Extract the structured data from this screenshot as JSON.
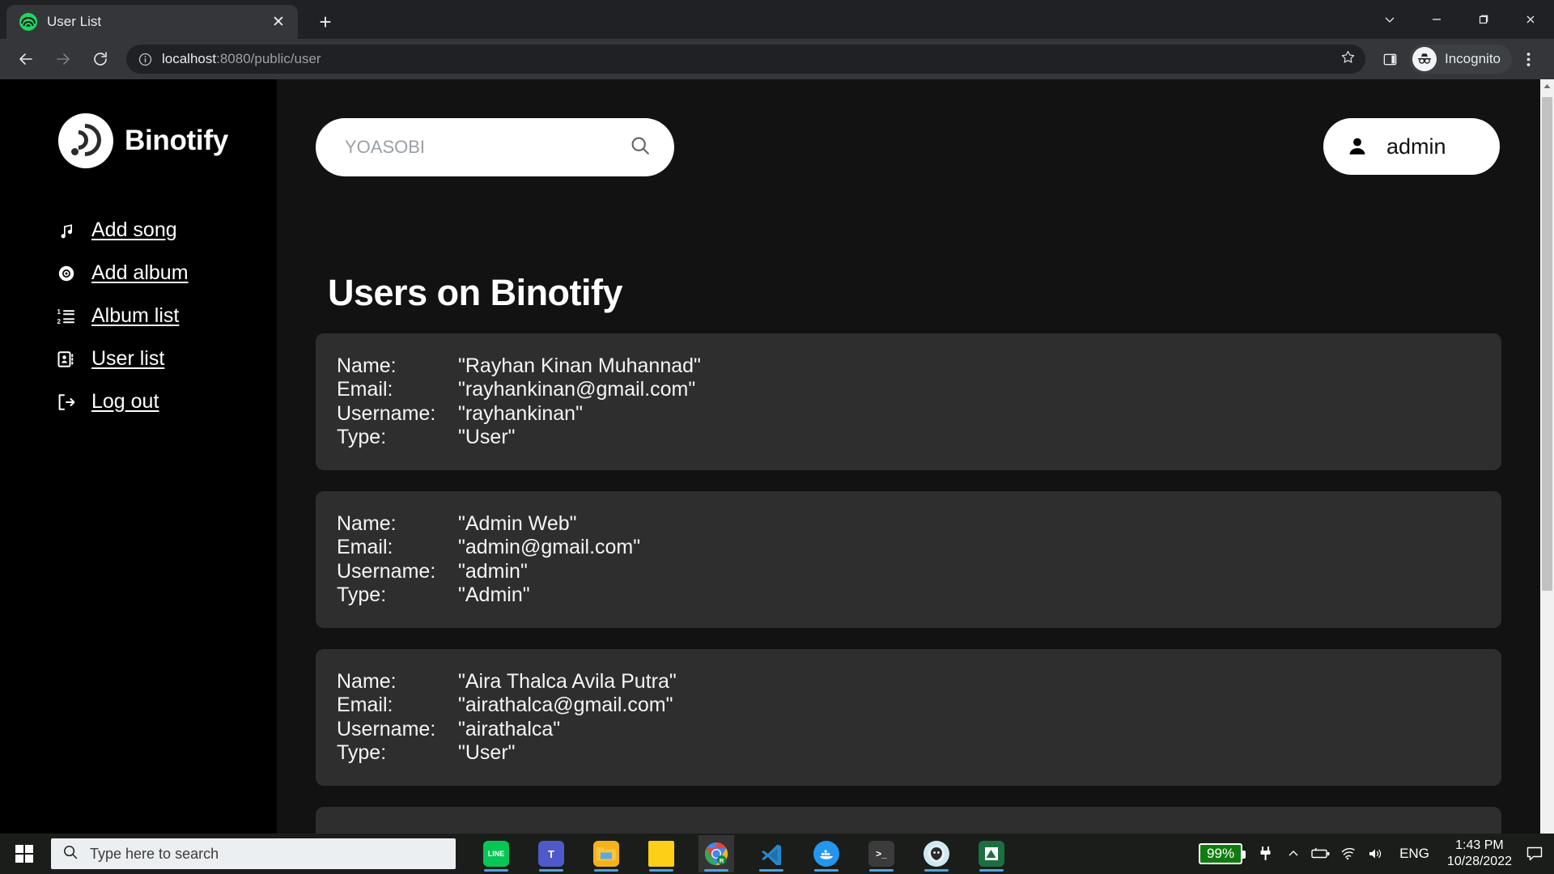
{
  "browser": {
    "tab": {
      "title": "User List",
      "favicon": "spotify-icon",
      "close_label": "✕"
    },
    "new_tab_label": "+",
    "address": {
      "scheme_host": "localhost",
      "path": ":8080/public/user",
      "full": "localhost:8080/public/user"
    },
    "profile_label": "Incognito",
    "window_controls": {
      "search_tabs": "chevron-down-icon",
      "minimize": "minimize-icon",
      "maximize": "maximize-icon",
      "close": "close-icon"
    }
  },
  "sidebar": {
    "brand": "Binotify",
    "items": [
      {
        "label": "Add song",
        "icon": "music-note-icon"
      },
      {
        "label": "Add album",
        "icon": "disc-icon"
      },
      {
        "label": "Album list",
        "icon": "ordered-list-icon"
      },
      {
        "label": "User list",
        "icon": "contact-card-icon"
      },
      {
        "label": "Log out",
        "icon": "sign-out-icon"
      }
    ]
  },
  "topbar": {
    "search_placeholder": "YOASOBI",
    "search_value": "",
    "search_icon": "search-icon",
    "user_name": "admin",
    "user_icon": "person-icon"
  },
  "main": {
    "title": "Users on Binotify",
    "labels": {
      "name": "Name:",
      "email": "Email:",
      "username": "Username:",
      "type": "Type:"
    },
    "users": [
      {
        "name": "\"Rayhan Kinan Muhannad\"",
        "email": "\"rayhankinan@gmail.com\"",
        "username": "\"rayhankinan\"",
        "type": "\"User\""
      },
      {
        "name": "\"Admin Web\"",
        "email": "\"admin@gmail.com\"",
        "username": "\"admin\"",
        "type": "\"Admin\""
      },
      {
        "name": "\"Aira Thalca Avila Putra\"",
        "email": "\"airathalca@gmail.com\"",
        "username": "\"airathalca\"",
        "type": "\"User\""
      }
    ]
  },
  "taskbar": {
    "start_icon": "windows-logo-icon",
    "search_placeholder": "Type here to search",
    "apps": [
      {
        "name": "line",
        "label": "LINE",
        "color": "#06c755"
      },
      {
        "name": "microsoft-teams",
        "label": "T",
        "color": "#5059c9"
      },
      {
        "name": "file-explorer",
        "label": "",
        "color": "#ffc107"
      },
      {
        "name": "sticky-notes",
        "label": "",
        "color": "#fdd017"
      },
      {
        "name": "google-chrome",
        "label": "",
        "color": "#ffffff"
      },
      {
        "name": "visual-studio-code",
        "label": "",
        "color": "#2489ca"
      },
      {
        "name": "docker",
        "label": "",
        "color": "#2496ed"
      },
      {
        "name": "windows-terminal",
        "label": ">_",
        "color": "#3b3b3b"
      },
      {
        "name": "gitkraken",
        "label": "",
        "color": "#179287"
      },
      {
        "name": "excel",
        "label": "",
        "color": "#1d6f42"
      }
    ],
    "tray": {
      "battery_percent": "99%",
      "language": "ENG",
      "time": "1:43 PM",
      "date": "10/28/2022",
      "icons": [
        "plug-icon",
        "chevron-up-icon",
        "battery-icon",
        "wifi-icon",
        "volume-icon",
        "notification-icon"
      ]
    }
  },
  "colors": {
    "accent_green": "#1ed760",
    "card_bg": "#2e2e2e",
    "page_bg": "#121212",
    "battery_green": "#107c10"
  }
}
